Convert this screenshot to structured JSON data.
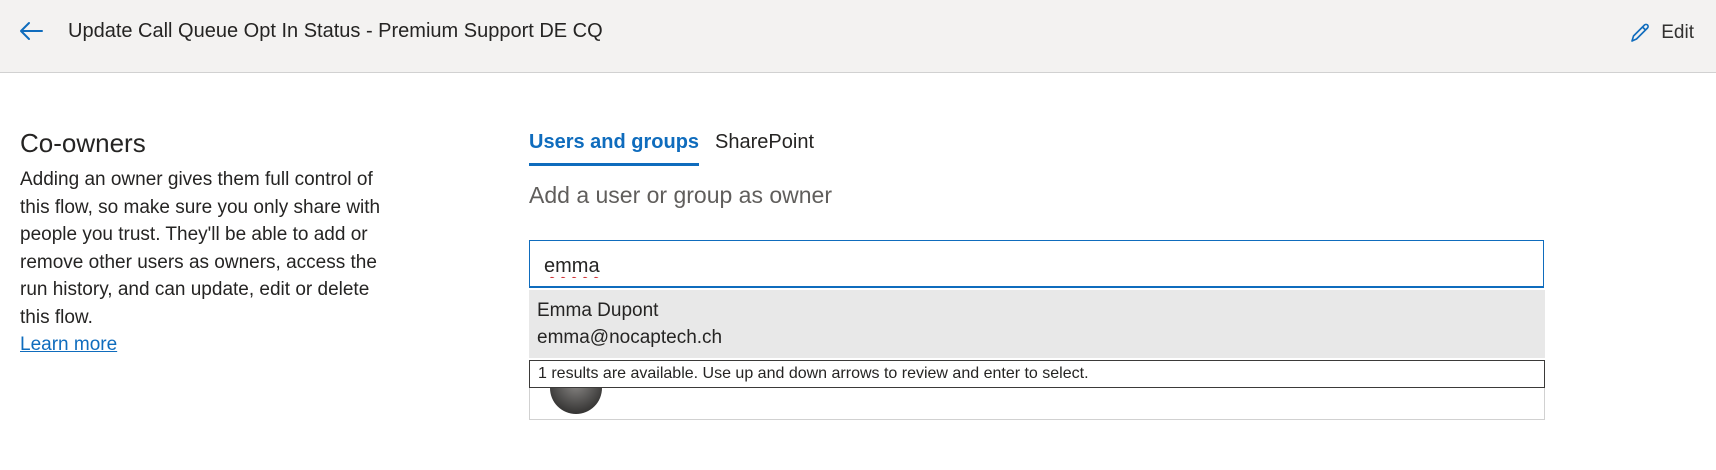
{
  "header": {
    "title": "Update Call Queue Opt In Status - Premium Support DE CQ",
    "edit_label": "Edit",
    "back_icon": "arrow-left-icon",
    "edit_icon": "pencil-icon"
  },
  "co_owners": {
    "title": "Co-owners",
    "description": "Adding an owner gives them full control of this flow, so make sure you only share with people you trust. They'll be able to add or remove other users as owners, access the run history, and can update, edit or delete this flow.",
    "learn_more": "Learn more"
  },
  "tabs": [
    {
      "label": "Users and groups",
      "active": true
    },
    {
      "label": "SharePoint",
      "active": false
    }
  ],
  "search": {
    "label": "Add a user or group as owner",
    "value": "emma"
  },
  "results": [
    {
      "name": "Emma Dupont",
      "email": "emma@nocaptech.ch"
    }
  ],
  "status_message": "1 results are available. Use up and down arrows to review and enter to select.",
  "colors": {
    "accent": "#0f6cbd",
    "header_bg": "#f3f2f1",
    "result_bg": "#e8e8e8"
  }
}
